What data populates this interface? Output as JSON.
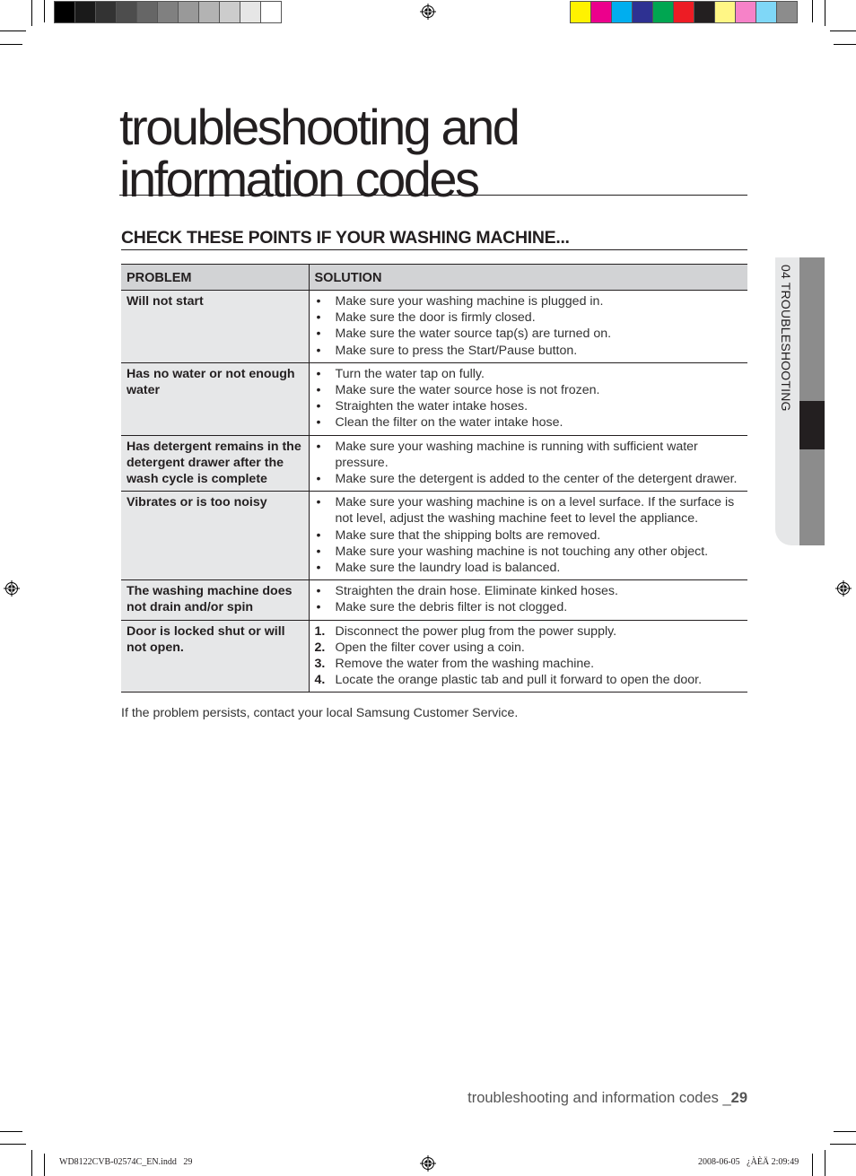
{
  "printer_marks": {
    "gray_swatches": [
      "#000000",
      "#1a1a1a",
      "#333333",
      "#4d4d4d",
      "#666666",
      "#808080",
      "#999999",
      "#b3b3b3",
      "#cccccc",
      "#e6e6e6",
      "#ffffff"
    ],
    "color_swatches": [
      "#fff200",
      "#ec008c",
      "#00aeef",
      "#2e3192",
      "#00a651",
      "#ed1c24",
      "#231f20",
      "#fff685",
      "#f682c8",
      "#7fd7f7",
      "#8c8c8c"
    ]
  },
  "page": {
    "title_line1": "troubleshooting and",
    "title_line2": "information codes",
    "section_heading": "CHECK THESE POINTS IF YOUR WASHING MACHINE...",
    "side_tab_label": "04 TROUBLESHOOTING",
    "footnote": "If the problem persists, contact your local Samsung Customer Service.",
    "footer_text": "troubleshooting and information codes _",
    "page_number": "29"
  },
  "table": {
    "headers": {
      "problem": "PROBLEM",
      "solution": "SOLUTION"
    },
    "rows": [
      {
        "problem": "Will not start",
        "list_type": "bullet",
        "solutions": [
          "Make sure your washing machine is plugged in.",
          "Make sure the door is firmly closed.",
          "Make sure the water source tap(s) are turned on.",
          "Make sure to press the Start/Pause button."
        ]
      },
      {
        "problem": "Has no water or not enough water",
        "list_type": "bullet",
        "solutions": [
          "Turn the water tap on fully.",
          "Make sure the water source hose is not frozen.",
          "Straighten the water intake hoses.",
          "Clean the filter on the water intake hose."
        ]
      },
      {
        "problem": "Has detergent remains in the detergent drawer after the wash cycle is complete",
        "list_type": "bullet",
        "solutions": [
          "Make sure your washing machine is running with sufficient water pressure.",
          "Make sure the detergent is added to the center of the detergent drawer."
        ]
      },
      {
        "problem": "Vibrates or is too noisy",
        "list_type": "bullet",
        "solutions": [
          "Make sure your washing machine is on a level surface. If the surface is not level, adjust the washing machine feet to level the appliance.",
          "Make sure that the shipping bolts are removed.",
          "Make sure your washing machine is not touching any other object.",
          "Make sure the laundry load is balanced."
        ]
      },
      {
        "problem": "The washing machine does not drain and/or spin",
        "list_type": "bullet",
        "solutions": [
          "Straighten the drain hose. Eliminate kinked hoses.",
          "Make sure the debris filter is not clogged."
        ]
      },
      {
        "problem": "Door is locked shut or will not open.",
        "list_type": "numbered",
        "solutions": [
          "Disconnect the power plug from the power supply.",
          "Open the filter cover using a coin.",
          "Remove the water from the washing machine.",
          "Locate the orange plastic tab and pull it forward to open the door."
        ]
      }
    ]
  },
  "slug": {
    "file_info": "WD8122CVB-02574C_EN.indd   29",
    "timestamp": "2008-06-05   ¿ÀÈÄ 2:09:49"
  }
}
